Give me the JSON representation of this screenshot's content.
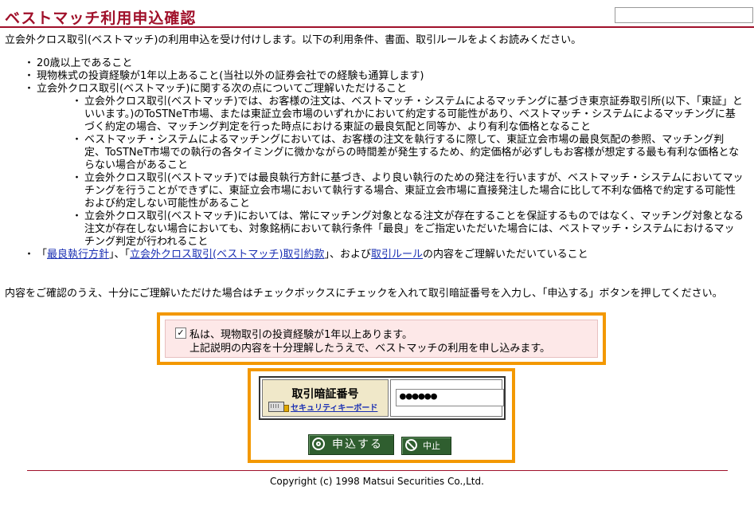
{
  "page": {
    "title": "ベストマッチ利用申込確認",
    "intro": "立会外クロス取引(ベストマッチ)の利用申込を受け付けします。以下の利用条件、書面、取引ルールをよくお読みください。"
  },
  "conditions": {
    "items": [
      "20歳以上であること",
      "現物株式の投資経験が1年以上あること(当社以外の証券会社での経験も通算します)",
      "立会外クロス取引(ベストマッチ)に関する次の点についてご理解いただけること"
    ],
    "sub_items": [
      "立会外クロス取引(ベストマッチ)では、お客様の注文は、ベストマッチ・システムによるマッチングに基づき東京証券取引所(以下、「東証」といいます。)のToSTNeT市場、または東証立会市場のいずれかにおいて約定する可能性があり、ベストマッチ・システムによるマッチングに基づく約定の場合、マッチング判定を行った時点における東証の最良気配と同等か、より有利な価格となること",
      "ベストマッチ・システムによるマッチングにおいては、お客様の注文を執行するに際して、東証立会市場の最良気配の参照、マッチング判定、ToSTNeT市場での執行の各タイミングに微かながらの時間差が発生するため、約定価格が必ずしもお客様が想定する最も有利な価格とならない場合があること",
      "立会外クロス取引(ベストマッチ)では最良執行方針に基づき、より良い執行のための発注を行いますが、ベストマッチ・システムにおいてマッチングを行うことができずに、東証立会市場において執行する場合、東証立会市場に直接発注した場合に比して不利な価格で約定する可能性および約定しない可能性があること",
      "立会外クロス取引(ベストマッチ)においては、常にマッチング対象となる注文が存在することを保証するものではなく、マッチング対象となる注文が存在しない場合においても、対象銘柄において執行条件「最良」をご指定いただいた場合には、ベストマッチ・システムにおけるマッチング判定が行われること"
    ],
    "docs": {
      "prefix": "「",
      "link1": "最良執行方針",
      "sep": "」、「",
      "link2": "立会外クロス取引(ベストマッチ)取引約款",
      "mid": "」、および",
      "link3": "取引ルール",
      "suffix": "の内容をご理解いただいていること"
    }
  },
  "confirm_text": "内容をご確認のうえ、十分にご理解いただけた場合はチェックボックスにチェックを入れて取引暗証番号を入力し、「申込する」ボタンを押してください。",
  "agreement": {
    "checked_mark": "✓",
    "line1": "私は、現物取引の投資経験が1年以上あります。",
    "line2": "上記説明の内容を十分理解したうえで、ベストマッチの利用を申し込みます。"
  },
  "pin": {
    "label": "取引暗証番号",
    "keyboard_link": "セキュリティキーボード",
    "masked_value": "●●●●●●"
  },
  "buttons": {
    "apply": "申込する",
    "cancel": "中止"
  },
  "footer": {
    "copyright": "Copyright (c) 1998 Matsui Securities Co.,Ltd."
  },
  "colors": {
    "title": "#a0102a",
    "highlight_border": "#f39800",
    "agreement_bg": "#fde8e8",
    "pin_label_bg": "#f0e8c9",
    "button_bg": "#2f5e2f",
    "link": "#1a2fb3"
  }
}
